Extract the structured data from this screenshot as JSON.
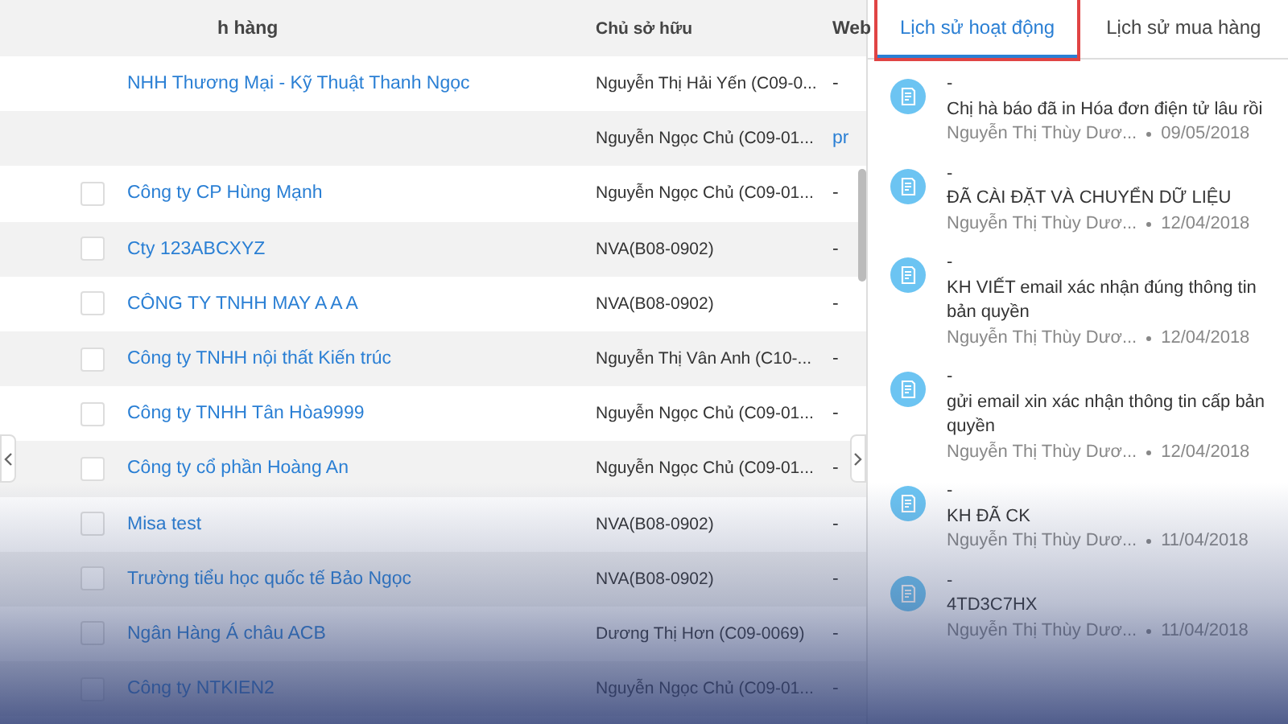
{
  "table": {
    "columns": [
      "h hàng",
      "Chủ sở hữu",
      "Web"
    ],
    "rows": [
      {
        "name": "NHH Thương Mại - Kỹ Thuật Thanh Ngọc",
        "owner": "Nguyễn Thị Hải Yến (C09-0...",
        "web": "-"
      },
      {
        "owner": "Nguyễn Ngọc Chủ (C09-01...",
        "web": "pr"
      },
      {
        "checked": false,
        "name": "Công ty CP Hùng Mạnh",
        "owner": "Nguyễn Ngọc Chủ (C09-01...",
        "web": "-"
      },
      {
        "checked": false,
        "name": "Cty 123ABCXYZ",
        "owner": "NVA(B08-0902)",
        "web": "-"
      },
      {
        "checked": false,
        "name": "CÔNG TY TNHH MAY A A A",
        "owner": "NVA(B08-0902)",
        "web": "-"
      },
      {
        "checked": false,
        "name": "Công ty TNHH nội thất Kiến trúc",
        "owner": "Nguyễn Thị Vân Anh (C10-...",
        "web": "-"
      },
      {
        "checked": false,
        "name": "Công ty TNHH Tân Hòa9999",
        "owner": "Nguyễn Ngọc Chủ (C09-01...",
        "web": "-"
      },
      {
        "checked": false,
        "name": "Công ty cổ phần Hoàng An",
        "owner": "Nguyễn Ngọc Chủ (C09-01...",
        "web": "-"
      },
      {
        "checked": false,
        "name": "Misa test",
        "owner": "NVA(B08-0902)",
        "web": "-"
      },
      {
        "checked": false,
        "name": "Trường tiểu học quốc tế Bảo Ngọc",
        "owner": "NVA(B08-0902)",
        "web": "-"
      },
      {
        "checked": false,
        "name": "Ngân Hàng Á châu ACB",
        "owner": "Dương Thị Hơn (C09-0069)",
        "web": "-"
      },
      {
        "checked": false,
        "name": "Công ty NTKIEN2",
        "owner": "Nguyễn Ngọc Chủ (C09-01...",
        "web": "-"
      }
    ]
  },
  "tabs": [
    {
      "label": "Lịch sử hoạt động",
      "selected": true
    },
    {
      "label": "Lịch sử mua hàng",
      "selected": false
    }
  ],
  "activities": [
    {
      "title": "-",
      "text": "Chị hà báo đã in Hóa đơn điện tử lâu rồi",
      "author": "Nguyễn Thị Thùy Dươ...",
      "date": "09/05/2018"
    },
    {
      "title": "-",
      "text": "ĐÃ CÀI ĐẶT VÀ CHUYỂN DỮ LIỆU",
      "author": "Nguyễn Thị Thùy Dươ...",
      "date": "12/04/2018"
    },
    {
      "title": "-",
      "text": "KH VIẾT email xác nhận đúng thông tin bản quyền",
      "author": "Nguyễn Thị Thùy Dươ...",
      "date": "12/04/2018"
    },
    {
      "title": "-",
      "text": "gửi email xin xác nhận thông tin cấp bản quyền",
      "author": "Nguyễn Thị Thùy Dươ...",
      "date": "12/04/2018"
    },
    {
      "title": "-",
      "text": "KH ĐÃ CK",
      "author": "Nguyễn Thị Thùy Dươ...",
      "date": "11/04/2018"
    },
    {
      "title": "-",
      "text": "4TD3C7HX",
      "author": "Nguyễn Thị Thùy Dươ...",
      "date": "11/04/2018"
    }
  ]
}
